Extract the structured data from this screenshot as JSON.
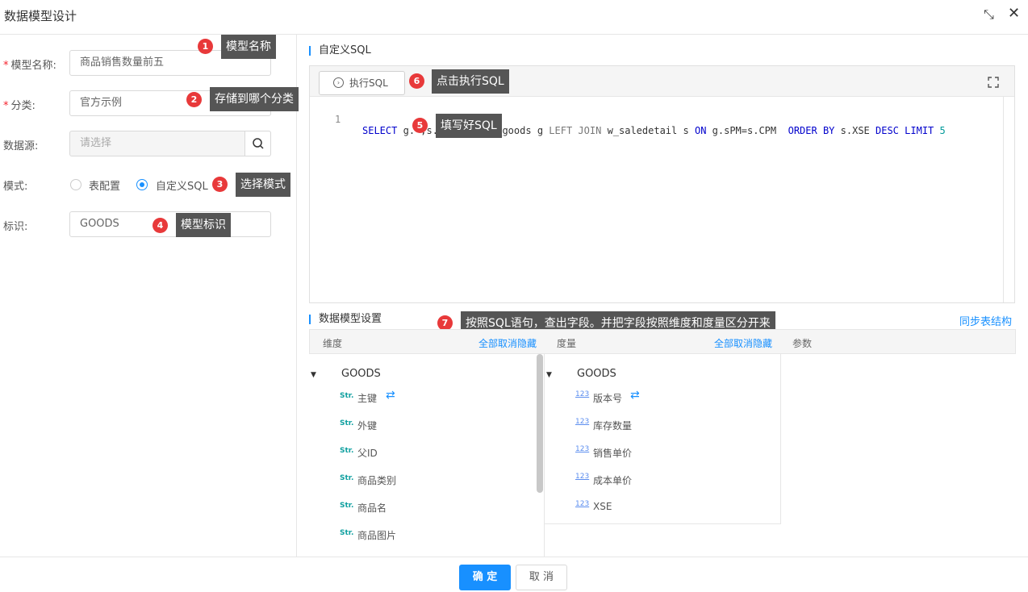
{
  "window": {
    "title": "数据模型设计"
  },
  "form": {
    "name_label": "模型名称:",
    "name_value": "商品销售数量前五",
    "category_label": "分类:",
    "category_value": "官方示例",
    "datasource_label": "数据源:",
    "datasource_placeholder": "请选择",
    "mode_label": "模式:",
    "mode_options": [
      "表配置",
      "自定义SQL"
    ],
    "mode_selected": "自定义SQL",
    "id_label": "标识:",
    "id_value": "GOODS"
  },
  "editor": {
    "section_title": "自定义SQL",
    "exec_label": "执行SQL",
    "line_number": "1",
    "sql": "SELECT g.*,s.XSE FROM w_goods g LEFT JOIN w_saledetail s ON g.sPM=s.CPM  ORDER BY s.XSE DESC LIMIT 5"
  },
  "model": {
    "section_title": "数据模型设置",
    "sync_link": "同步表结构",
    "dimension_header": "维度",
    "measure_header": "度量",
    "param_header": "参数",
    "unhide_all": "全部取消隐藏",
    "dimension_root": "GOODS",
    "dimension_type": "Str.",
    "dimensions": [
      "主键",
      "外键",
      "父ID",
      "商品类别",
      "商品名",
      "商品图片"
    ],
    "measure_root": "GOODS",
    "measure_type": "123",
    "measures": [
      "版本号",
      "库存数量",
      "销售单价",
      "成本单价",
      "XSE"
    ]
  },
  "annotations": [
    {
      "num": "1",
      "text": "模型名称"
    },
    {
      "num": "2",
      "text": "存储到哪个分类"
    },
    {
      "num": "3",
      "text": "选择模式"
    },
    {
      "num": "4",
      "text": "模型标识"
    },
    {
      "num": "5",
      "text": "填写好SQL"
    },
    {
      "num": "6",
      "text": "点击执行SQL"
    },
    {
      "num": "7",
      "text": "按照SQL语句，查出字段。并把字段按照维度和度量区分开来"
    }
  ],
  "footer": {
    "ok": "确 定",
    "cancel": "取 消"
  },
  "colors": {
    "primary": "#1890ff",
    "badge": "#e8393a",
    "tooltip": "#555555"
  }
}
